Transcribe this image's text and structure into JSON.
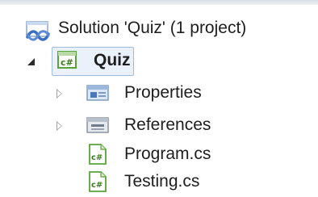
{
  "solution_explorer": {
    "solution": {
      "label": "Solution 'Quiz' (1 project)",
      "icon": "solution-icon"
    },
    "project": {
      "label": "Quiz",
      "icon": "csharp-project-icon",
      "expanded": true,
      "selected": true
    },
    "children": [
      {
        "label": "Properties",
        "icon": "properties-folder-icon",
        "expandable": true
      },
      {
        "label": "References",
        "icon": "references-folder-icon",
        "expandable": true
      },
      {
        "label": "Program.cs",
        "icon": "csharp-file-icon",
        "expandable": false
      },
      {
        "label": "Testing.cs",
        "icon": "csharp-file-icon",
        "expandable": false
      }
    ]
  },
  "colors": {
    "selection_fill": "#eaf1fb",
    "selection_border": "#9fbbe0",
    "solution_icon": "#3c6fc4",
    "csharp_icon": "#5aa23a"
  }
}
